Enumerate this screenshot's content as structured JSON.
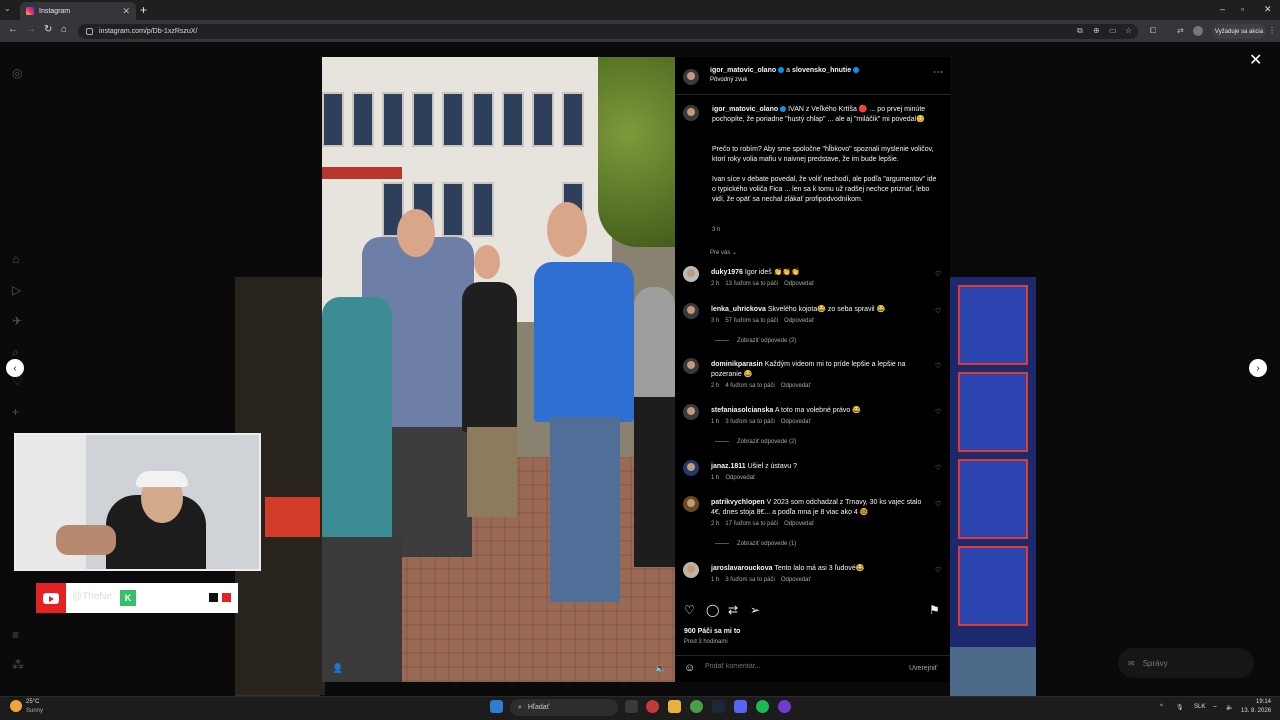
{
  "browser": {
    "tab_title": "Instagram",
    "new_tab": "+",
    "url": "instagram.com/p/Db-1xzRszuX/",
    "update_button": "Vyžaduje sa akcia",
    "window_controls": [
      "–",
      "▫",
      "✕"
    ]
  },
  "instagram": {
    "sidebar_icons": [
      "instagram-icon",
      "home-icon",
      "reels-icon",
      "send-icon",
      "search-icon",
      "heart-icon",
      "plus-icon",
      "menu-icon",
      "apps-icon"
    ],
    "post": {
      "author": "igor_matovic_olano",
      "coauthor_connector": "a",
      "coauthor": "slovensko_hnutie",
      "audio": "Pôvodný zvuk",
      "caption_author": "igor_matovic_olano",
      "caption_first": "IVAN z Veľkého Krtíša 🔴 ... po prvej minúte pochopíte, že poriadne \"hustý chlap\" ... ale aj \"miláčik\" mi povedal😊",
      "caption_rest": "Prečo to robím? Aby sme spoločne \"hĺbkovo\" spoznali myslenie voličov, ktorí roky volia mafiu v naivnej predstave, že im bude lepšie.\n\nIvan síce v debate povedal, že voliť nechodí, ale podľa \"argumentov\" ide o typického voliča Fica ... len sa k tomu už radšej nechce priznať, lebo vidí, že opäť sa nechal zlákať profipodvodníkom.",
      "caption_time": "3 h",
      "see_translation": "Pre vás ⌄",
      "likes": "900 Páči sa mi to",
      "posted_ago": "Pred 3 hodinami",
      "add_comment_placeholder": "Pridať komentár...",
      "publish": "Uverejniť"
    },
    "comments": [
      {
        "user": "duky1976",
        "text": "Igor ideš 👏👏👏",
        "time": "2 h",
        "likes": "13 ľuďom sa to páči",
        "reply": "Odpovedať"
      },
      {
        "user": "lenka_uhrickova",
        "text": "Skvelého kojota😂 zo seba spravil 😂",
        "time": "3 h",
        "likes": "57 ľuďom sa to páči",
        "reply": "Odpovedať",
        "show_replies": "Zobraziť odpovede (2)"
      },
      {
        "user": "dominikparasin",
        "text": "Každým videom mi to príde lepšie a lepšie na pozeranie 😂",
        "time": "2 h",
        "likes": "4 ľuďom sa to páči",
        "reply": "Odpovedať"
      },
      {
        "user": "stefaniasolcianska",
        "text": "A toto ma volebné právo 😂",
        "time": "1 h",
        "likes": "3 ľuďom sa to páči",
        "reply": "Odpovedať",
        "show_replies": "Zobraziť odpovede (2)"
      },
      {
        "user": "janaz.1811",
        "text": "Ušiel z ústavu ?",
        "time": "1 h",
        "likes": "",
        "reply": "Odpovedať"
      },
      {
        "user": "patrikvychlopen",
        "text": "V 2023 som odchadzal z Trnavy, 30 ks vajec stalo 4€, dnes stoja 8€... a podľa mna je 8 viac ako 4 🤓",
        "time": "2 h",
        "likes": "17 ľuďom sa to páči",
        "reply": "Odpovedať",
        "show_replies": "Zobraziť odpovede (1)"
      },
      {
        "user": "jaroslavarouckova",
        "text": "Tento lalo má asi 3 ľudové😂",
        "time": "1 h",
        "likes": "3 ľuďom sa to páči",
        "reply": "Odpovedať"
      }
    ],
    "messages_pill": "Správy"
  },
  "overlay": {
    "handle": "@TheNe",
    "badge": "K"
  },
  "taskbar": {
    "temperature": "25°C",
    "weather": "Sunny",
    "search_placeholder": "Hľadať",
    "language": "SLK",
    "time": "19:14",
    "date": "13. 8. 2026"
  },
  "colors": {
    "instagram_bg": "#000000",
    "verified": "#0095f6",
    "youtube_red": "#e52222",
    "accent_green": "#35c16a"
  }
}
